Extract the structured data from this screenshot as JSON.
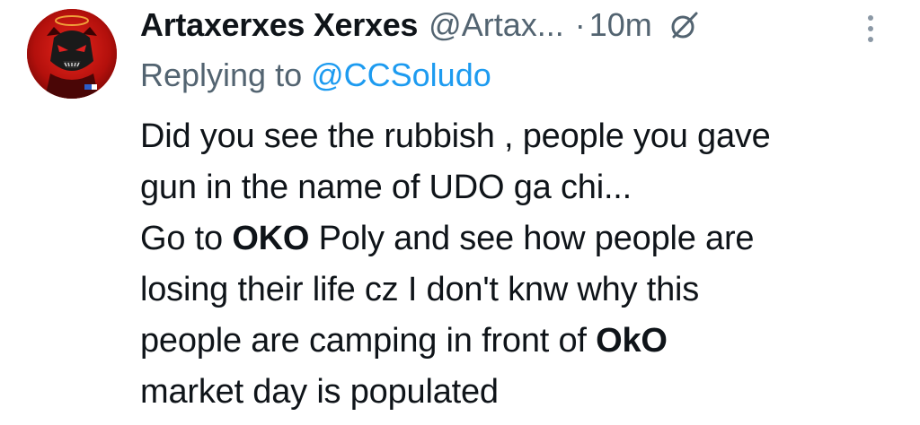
{
  "tweet": {
    "author": {
      "display_name": "Artaxerxes Xerxes",
      "handle": "@Artax...",
      "avatar": "red-masked-figure-avatar"
    },
    "separator": "·",
    "time": "10m",
    "reply_prefix": "Replying to ",
    "reply_to": "@CCSoludo",
    "body": {
      "line1": "Did you see the rubbish , people you gave",
      "line2": "gun in the name of UDO ga chi...",
      "line3_a": "Go to ",
      "line3_bold": "OKO",
      "line3_b": " Poly and see how people are",
      "line4": "losing their life cz I don't knw  why this",
      "line5_a": "people are camping in front of  ",
      "line5_bold": "OkO",
      "line6": "market day is populated"
    },
    "icons": {
      "grok": "grok-icon",
      "more": "more-vertical-icon"
    },
    "colors": {
      "text": "#0f1419",
      "muted": "#536471",
      "link": "#1d9bf0"
    }
  }
}
